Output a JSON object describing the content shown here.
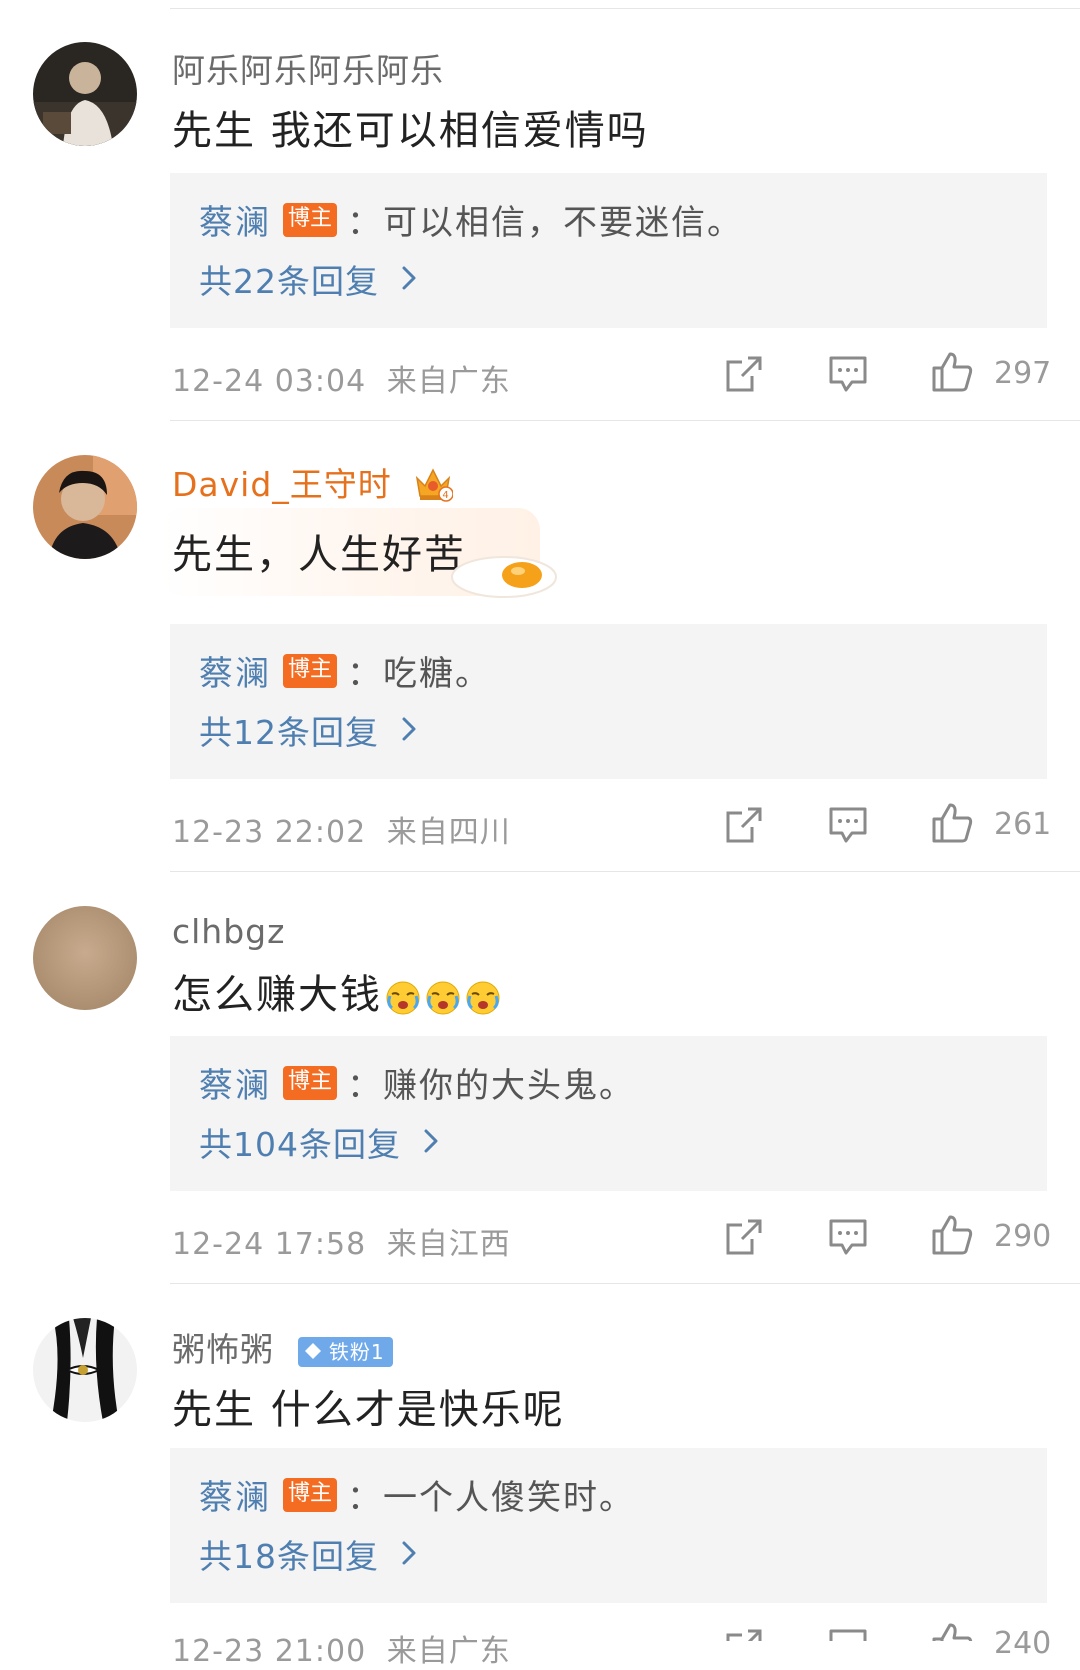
{
  "comments": [
    {
      "username": "阿乐阿乐阿乐阿乐",
      "content": "先生 我还可以相信爱情吗",
      "reply": {
        "author": "蔡澜",
        "badge": "博主",
        "separator": "：",
        "text": "可以相信，不要迷信。",
        "count_label": "共22条回复"
      },
      "time": "12-24 03:04",
      "location": "来自广东",
      "likes": "297"
    },
    {
      "username": "David_王守时",
      "content": "先生，人生好苦",
      "reply": {
        "author": "蔡澜",
        "badge": "博主",
        "separator": "：",
        "text": "吃糖。",
        "count_label": "共12条回复"
      },
      "time": "12-23 22:02",
      "location": "来自四川",
      "likes": "261"
    },
    {
      "username": "clhbgz",
      "content": "怎么赚大钱",
      "reply": {
        "author": "蔡澜",
        "badge": "博主",
        "separator": "：",
        "text": "赚你的大头鬼。",
        "count_label": "共104条回复"
      },
      "time": "12-24 17:58",
      "location": "来自江西",
      "likes": "290"
    },
    {
      "username": "粥怖粥",
      "fan_badge": "铁粉1",
      "content": "先生 什么才是快乐呢",
      "reply": {
        "author": "蔡澜",
        "badge": "博主",
        "separator": "：",
        "text": "一个人傻笑时。",
        "count_label": "共18条回复"
      },
      "time": "12-23 21:00",
      "location": "来自广东",
      "likes": "240"
    }
  ],
  "colors": {
    "link_blue": "#4f7fb0",
    "blogger_badge": "#f36c21",
    "vip_name": "#e6711d",
    "fan_badge": "#6fa9ea",
    "reply_bg": "#f4f4f4",
    "meta_gray": "#9a9a9a"
  },
  "icons": {
    "share": "share-icon",
    "comment": "comment-icon",
    "like": "thumbs-up-icon",
    "chevron": "chevron-right-icon",
    "crown": "crown-icon",
    "egg": "fried-egg-icon",
    "crying_emoji": "crying-face-emoji"
  }
}
